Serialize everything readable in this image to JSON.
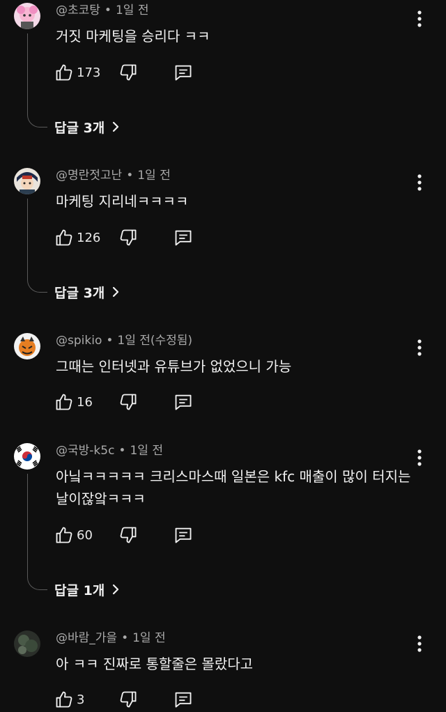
{
  "comments": [
    {
      "author": "@초코탕",
      "time": "1일 전",
      "text": "거짓 마케팅을 승리다 ㅋㅋ",
      "likes": "173",
      "replies_label": "답글 3개"
    },
    {
      "author": "@명란젓고난",
      "time": "1일 전",
      "text": "마케팅 지리네ㅋㅋㅋㅋ",
      "likes": "126",
      "replies_label": "답글 3개"
    },
    {
      "author": "@spikio",
      "time": "1일 전(수정됨)",
      "text": "그때는 인터넷과 유튜브가 없었으니 가능",
      "likes": "16"
    },
    {
      "author": "@국방-k5c",
      "time": "1일 전",
      "text": "아닠ㅋㅋㅋㅋㅋ 크리스마스때 일본은 kfc 매출이 많이 터지는 날이잖앜ㅋㅋㅋ",
      "likes": "60",
      "replies_label": "답글 1개"
    },
    {
      "author": "@바람_가을",
      "time": "1일 전",
      "text": "아 ㅋㅋ 진짜로 통할줄은 몰랐다고",
      "likes": "3"
    }
  ],
  "icons": {
    "like": "thumb-up-icon",
    "dislike": "thumb-down-icon",
    "reply": "comment-reply-icon",
    "menu": "more-vertical-icon",
    "chevron": "chevron-right-icon"
  },
  "colors": {
    "background": "#0f0f0f",
    "text": "#f1f1f1",
    "meta": "#aaaaaa",
    "thread_line": "#5a5a5a"
  }
}
